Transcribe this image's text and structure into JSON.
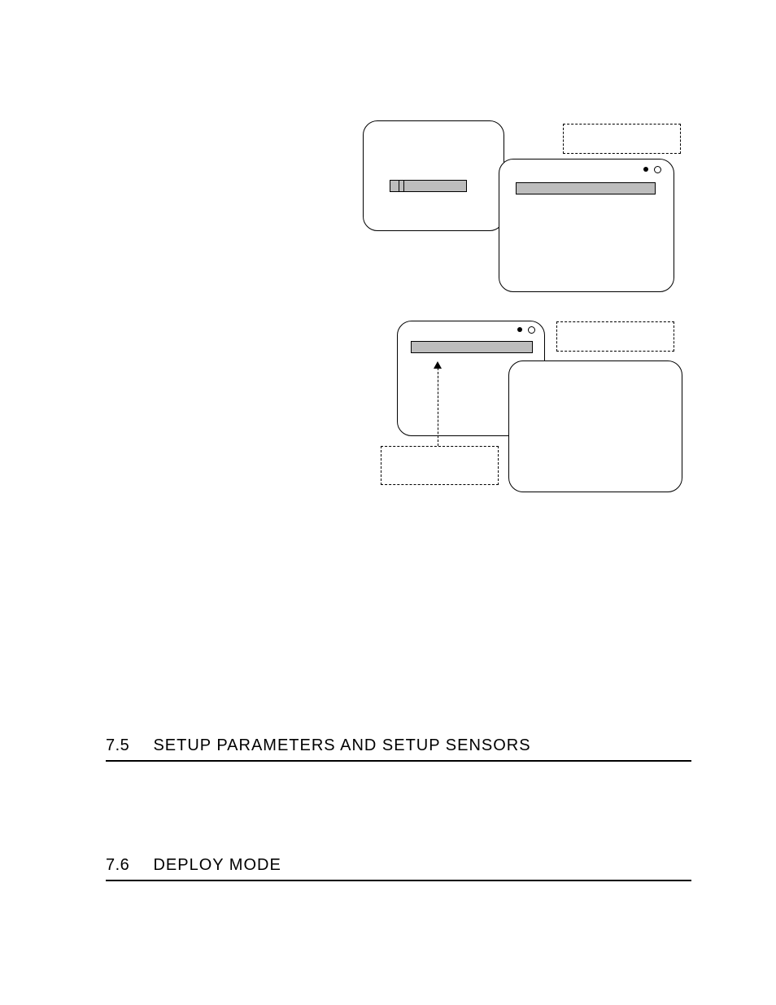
{
  "sections": {
    "s75": {
      "num": "7.5",
      "title": "SETUP PARAMETERS AND SETUP SENSORS"
    },
    "s76": {
      "num": "7.6",
      "title": "DEPLOY MODE"
    }
  }
}
